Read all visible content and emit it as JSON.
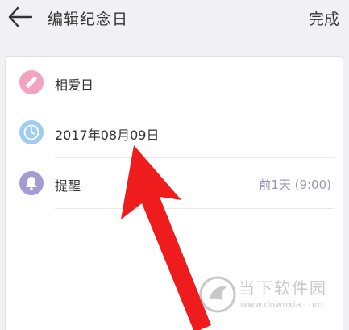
{
  "header": {
    "title": "编辑纪念日",
    "done_label": "完成",
    "back_icon": "arrow-left-icon"
  },
  "card": {
    "rows": [
      {
        "id": "name",
        "icon": "pencil-icon",
        "icon_color": "#f2a3be",
        "label": "相爱日",
        "value": ""
      },
      {
        "id": "date",
        "icon": "clock-icon",
        "icon_color": "#9fcdf0",
        "label": "2017年08月09日",
        "value": ""
      },
      {
        "id": "reminder",
        "icon": "bell-icon",
        "icon_color": "#a49bd3",
        "label": "提醒",
        "value": "前1天 (9:00)"
      }
    ]
  },
  "annotation": {
    "arrow_color": "#ee1c1c",
    "arrow_icon": "red-arrow-pointer"
  },
  "watermark": {
    "title": "当下软件园",
    "url": "www.downxia.com",
    "logo_icon": "downxia-logo-icon"
  },
  "colors": {
    "background": "#f1f0f4",
    "card": "#ffffff",
    "text": "#333333",
    "secondary_text": "#9a96b5"
  }
}
